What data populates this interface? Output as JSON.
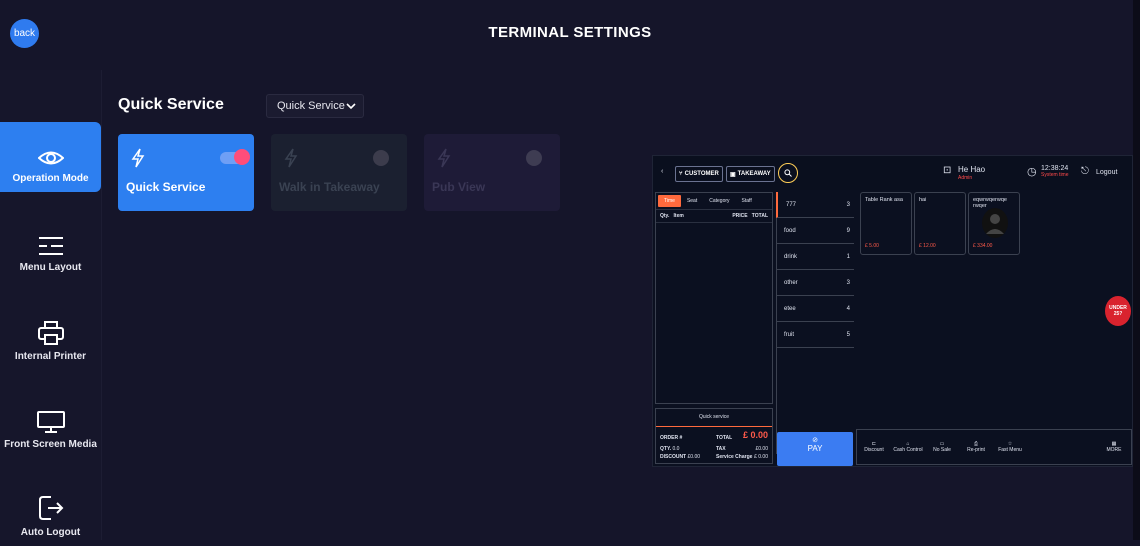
{
  "header": {
    "title": "TERMINAL SETTINGS",
    "back_label": "back"
  },
  "sidebar": {
    "items": [
      {
        "label": "Operation Mode",
        "icon": "eye-icon",
        "active": true
      },
      {
        "label": "Menu Layout",
        "icon": "menu-layout-icon",
        "active": false
      },
      {
        "label": "Internal Printer",
        "icon": "printer-icon",
        "active": false
      },
      {
        "label": "Front Screen Media",
        "icon": "monitor-icon",
        "active": false
      },
      {
        "label": "Auto Logout",
        "icon": "logout-icon",
        "active": false
      }
    ]
  },
  "main": {
    "section_title": "Quick Service",
    "mode_select": {
      "value": "Quick Service"
    },
    "cards": [
      {
        "label": "Quick Service",
        "enabled": true
      },
      {
        "label": "Walk in Takeaway",
        "enabled": false
      },
      {
        "label": "Pub View",
        "enabled": false
      }
    ]
  },
  "preview": {
    "chips": [
      "CUSTOMER",
      "TAKEAWAY"
    ],
    "user": {
      "name": "He Hao",
      "role": "Admin"
    },
    "clock": {
      "time": "12:38:24",
      "label": "System time"
    },
    "logout": "Logout",
    "order_tabs": [
      "Time",
      "Seat",
      "Category",
      "Staff"
    ],
    "order_columns": [
      "Qty.",
      "Item",
      "PRICE",
      "TOTAL"
    ],
    "summary": {
      "mode": "Quick service",
      "order_label": "ORDER #",
      "total_label": "TOTAL",
      "total_value": "£ 0.00",
      "qty_label": "QTY.",
      "qty_value": "0.0",
      "tax_label": "TAX",
      "tax_value": "£0.00",
      "discount_label": "DISCOUNT",
      "discount_value": "£0.00",
      "service_label": "Service Charge",
      "service_value": "£ 0.00"
    },
    "categories": [
      {
        "name": "777",
        "count": "3"
      },
      {
        "name": "food",
        "count": "9"
      },
      {
        "name": "drink",
        "count": "1"
      },
      {
        "name": "other",
        "count": "3"
      },
      {
        "name": "etee",
        "count": "4"
      },
      {
        "name": "fruit",
        "count": "5"
      }
    ],
    "products": [
      {
        "name": "Table Rank asa",
        "price": "£ 5.00"
      },
      {
        "name": "hai",
        "price": "£ 12.00"
      },
      {
        "name": "eqwrwqerwqe rwqer",
        "price": "£ 334.00"
      }
    ],
    "pay_label": "PAY",
    "bottom_actions": [
      "Discount",
      "Cash Control",
      "No Sale",
      "Re-print",
      "Fast Menu",
      "MORE"
    ],
    "badge": "UNDER 25?"
  },
  "colors": {
    "accent": "#2d7ff0",
    "background": "#15152a",
    "toggle_on": "#ff4d7a",
    "orange": "#ff6a3d"
  }
}
